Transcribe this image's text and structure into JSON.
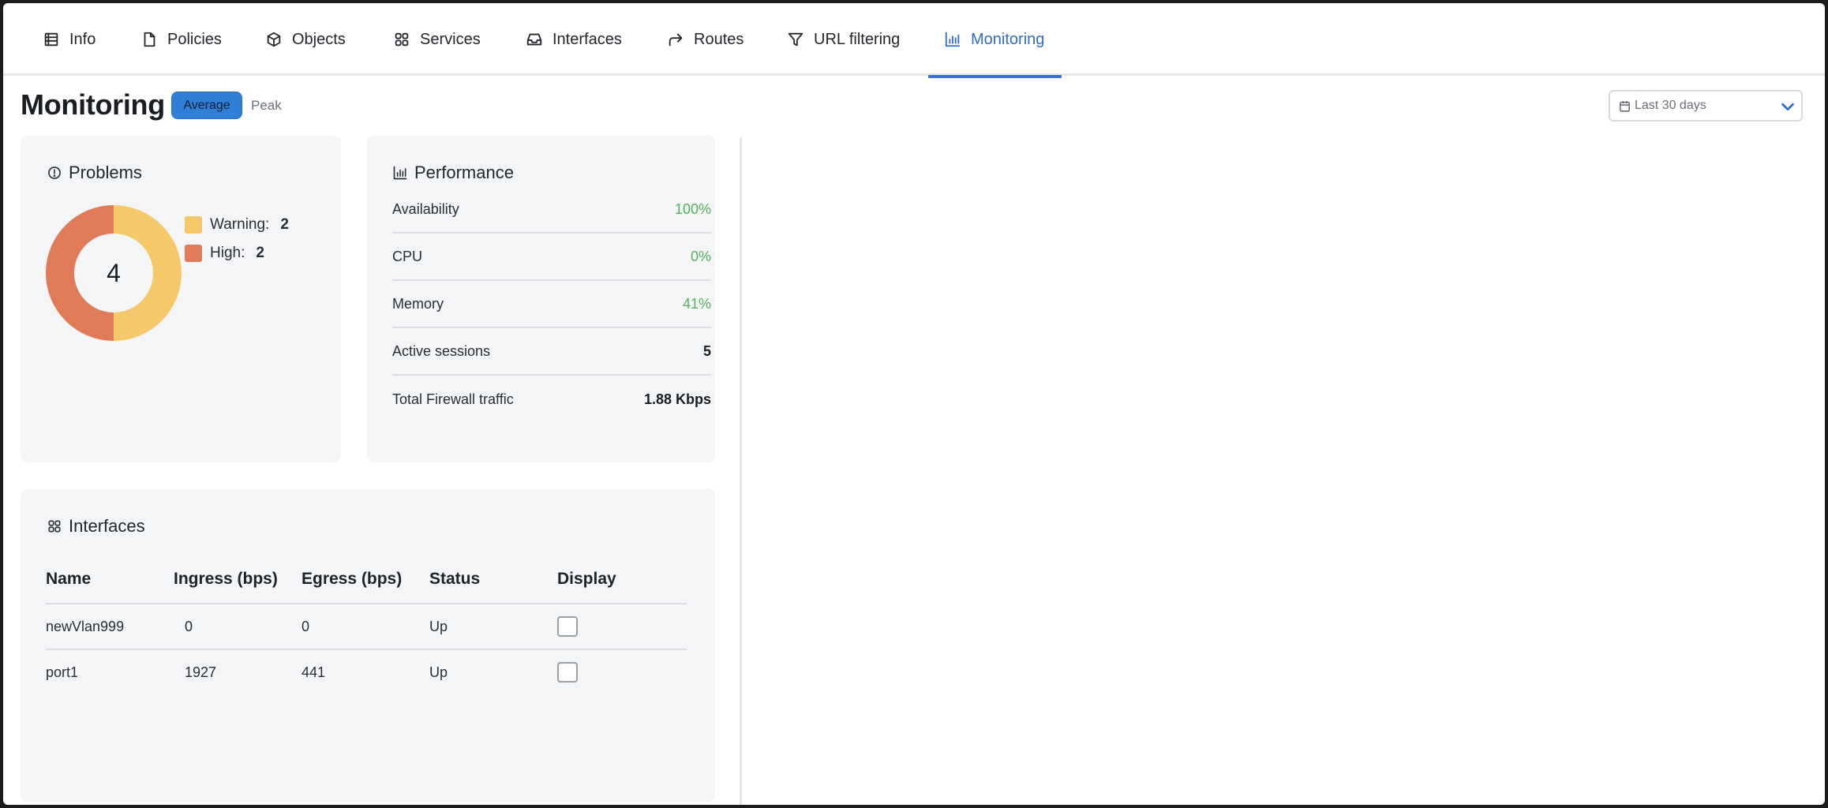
{
  "tabs": [
    {
      "label": "Info",
      "icon": "list-icon"
    },
    {
      "label": "Policies",
      "icon": "file-icon"
    },
    {
      "label": "Objects",
      "icon": "cube-icon"
    },
    {
      "label": "Services",
      "icon": "grid-icon"
    },
    {
      "label": "Interfaces",
      "icon": "inbox-icon"
    },
    {
      "label": "Routes",
      "icon": "forward-arrow-icon"
    },
    {
      "label": "URL filtering",
      "icon": "filter-icon"
    },
    {
      "label": "Monitoring",
      "icon": "bar-chart-icon",
      "active": true
    }
  ],
  "page": {
    "title": "Monitoring",
    "mode_average": "Average",
    "mode_peak": "Peak",
    "date_range": "Last 30 days"
  },
  "problems": {
    "title": "Problems",
    "total": "4",
    "items": [
      {
        "label": "Warning:",
        "count": "2",
        "value": 2,
        "color": "#f5c96a"
      },
      {
        "label": "High:",
        "count": "2",
        "value": 2,
        "color": "#e07b5a"
      }
    ]
  },
  "performance": {
    "title": "Performance",
    "rows": [
      {
        "label": "Availability",
        "value": "100%"
      },
      {
        "label": "CPU",
        "value": "0%"
      },
      {
        "label": "Memory",
        "value": "41%"
      },
      {
        "label": "Active sessions",
        "value": "5"
      },
      {
        "label": "Total Firewall traffic",
        "value": "1.88 Kbps"
      }
    ]
  },
  "interfaces": {
    "title": "Interfaces",
    "columns": [
      "Name",
      "Ingress (bps)",
      "Egress (bps)",
      "Status",
      "Display"
    ],
    "rows": [
      {
        "name": "newVlan999",
        "ingress": "0",
        "egress": "0",
        "status": "Up",
        "display": false
      },
      {
        "name": "port1",
        "ingress": "1927",
        "egress": "441",
        "status": "Up",
        "display": false
      }
    ]
  },
  "colors": {
    "accent": "#2f6ccf",
    "good": "#52b35b",
    "warning": "#f5c96a",
    "high": "#e07b5a"
  }
}
